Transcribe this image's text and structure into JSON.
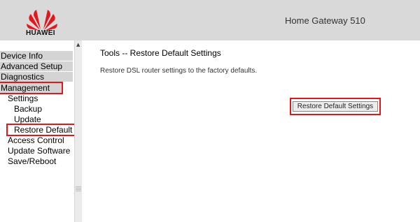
{
  "header": {
    "brand": "HUAWEI",
    "product": "Home Gateway 510",
    "logo_color": "#e4161c"
  },
  "sidebar": {
    "top_items": [
      {
        "label": "Device Info"
      },
      {
        "label": "Advanced Setup"
      },
      {
        "label": "Diagnostics"
      },
      {
        "label": "Management"
      }
    ],
    "sub_items": [
      {
        "label": "Settings"
      },
      {
        "label": "Backup"
      },
      {
        "label": "Update"
      },
      {
        "label": "Restore Default"
      },
      {
        "label": "Access Control"
      },
      {
        "label": "Update Software"
      },
      {
        "label": "Save/Reboot"
      }
    ]
  },
  "main": {
    "title": "Tools -- Restore Default Settings",
    "description": "Restore DSL router settings to the factory defaults.",
    "restore_button": "Restore Default Settings"
  },
  "highlight_color": "#e4161c"
}
